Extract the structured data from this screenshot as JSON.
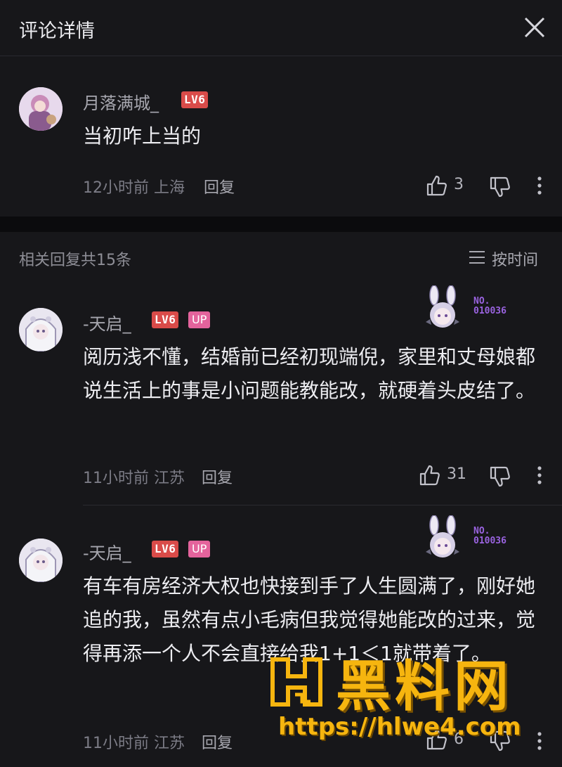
{
  "header": {
    "title": "评论详情"
  },
  "main_comment": {
    "username": "月落满城_",
    "level": "LV6",
    "text": "当初咋上当的",
    "time_location": "12小时前 上海",
    "reply_label": "回复",
    "likes": "3"
  },
  "replies_header": {
    "count_label": "相关回复共15条",
    "sort_label": "按时间"
  },
  "replies": [
    {
      "username": "-天启_",
      "level": "LV6",
      "up_badge": "UP",
      "fan_no": "NO.",
      "fan_num": "010036",
      "text": "阅历浅不懂，结婚前已经初现端倪，家里和丈母娘都说生活上的事是小问题能教能改，就硬着头皮结了。",
      "time_location": "11小时前 江苏",
      "reply_label": "回复",
      "likes": "31"
    },
    {
      "username": "-天启_",
      "level": "LV6",
      "up_badge": "UP",
      "fan_no": "NO.",
      "fan_num": "010036",
      "text": "有车有房经济大权也快接到手了人生圆满了，刚好她追的我，虽然有点小毛病但我觉得她能改的过来，觉得再添一个人不会直接给我1+1＜1就带着了。",
      "time_location": "11小时前 江苏",
      "reply_label": "回复",
      "likes": "6"
    }
  ],
  "watermark": {
    "title": "黑料网",
    "url": "https://hlwe4.com"
  },
  "colors": {
    "background": "#17171a",
    "level_badge": "#d94b49",
    "up_badge": "#e4639c",
    "fan_badge_text": "#9a63e0",
    "watermark": "#f6b50f"
  }
}
